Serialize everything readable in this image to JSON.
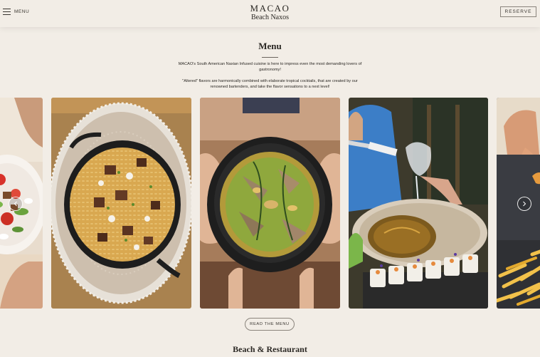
{
  "header": {
    "menu_label": "MENU",
    "brand_name": "MACAO",
    "brand_sub": "Beach Naxos",
    "reserve_label": "RESERVE"
  },
  "menu_section": {
    "title": "Menu",
    "description_1": "MACAO's South American Naxian Infused cuisine is here to impress even the most demanding lovers of gastronomy!",
    "description_2": "\"Altered\" flavors are harmonically combined with elaborate tropical cocktails, that are created by our renowned bartenders, and take the flavor sensations to a next level!"
  },
  "carousel": {
    "slides": [
      {
        "icon": "salad-photo"
      },
      {
        "icon": "orzo-pan-photo"
      },
      {
        "icon": "seafood-stew-photo"
      },
      {
        "icon": "wine-sushi-photo"
      },
      {
        "icon": "fries-photo"
      }
    ],
    "prev_icon": "chevron-left-icon",
    "next_icon": "chevron-right-icon"
  },
  "read_menu_label": "READ THE MENU",
  "next_section_title": "Beach & Restaurant",
  "colors": {
    "background": "#f2ede6",
    "text": "#2b2824",
    "border": "#8a847c"
  }
}
